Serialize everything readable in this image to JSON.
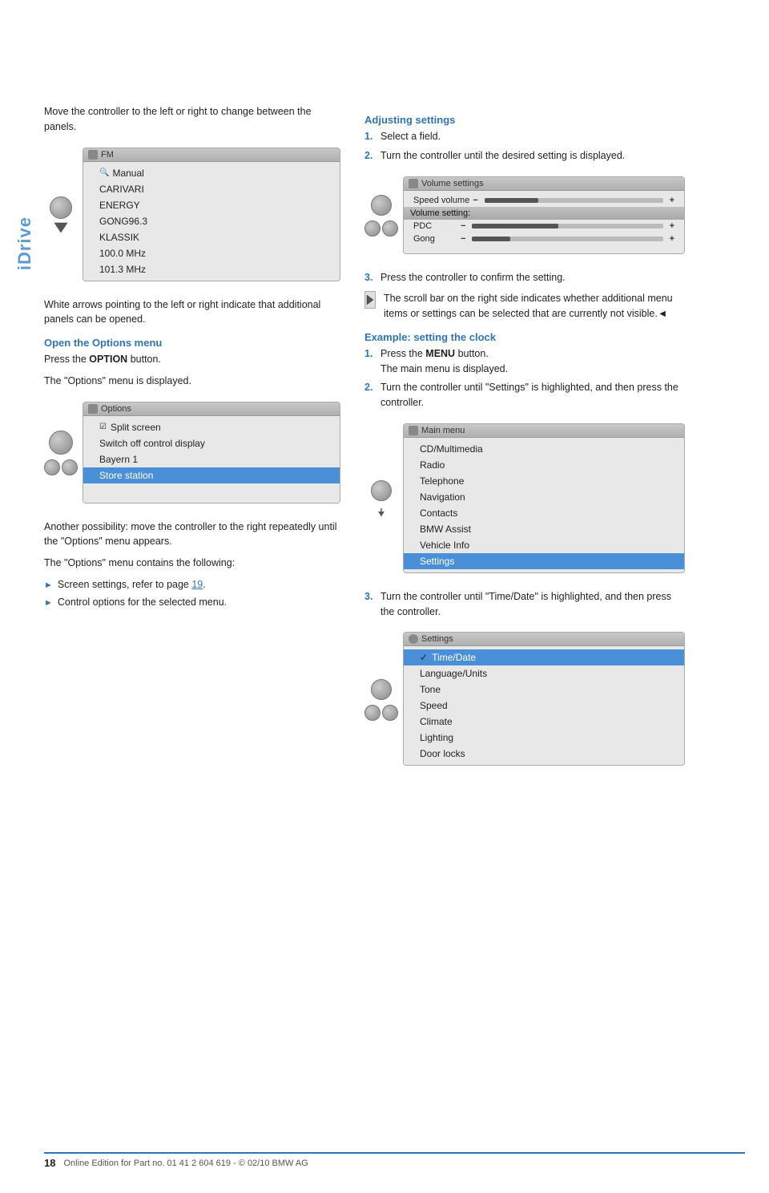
{
  "sidebar": {
    "label": "iDrive"
  },
  "left_col": {
    "intro_text": "Move the controller to the left or right to change between the panels.",
    "screenshot1": {
      "title_icon": "radio-icon",
      "title": "FM",
      "items": [
        {
          "label": "Manual",
          "selected": false,
          "icon": "search"
        },
        {
          "label": "CARIVARI",
          "selected": false
        },
        {
          "label": "ENERGY",
          "selected": false
        },
        {
          "label": "GONG96.3",
          "selected": false
        },
        {
          "label": "KLASSIK",
          "selected": false
        },
        {
          "label": "100.0 MHz",
          "selected": false
        },
        {
          "label": "101.3 MHz",
          "selected": false
        }
      ]
    },
    "white_arrows_text": "White arrows pointing to the left or right indicate that additional panels can be opened.",
    "options_section": {
      "heading": "Open the Options menu",
      "step1": "Press the ",
      "step1_bold": "OPTION",
      "step1_end": " button.",
      "step2": "The \"Options\" menu is displayed.",
      "screenshot2": {
        "title": "Options",
        "items": [
          {
            "label": "Split screen",
            "icon": "checkbox",
            "selected": false
          },
          {
            "label": "Switch off control display",
            "selected": false
          },
          {
            "label": "Bayern 1",
            "selected": false
          },
          {
            "label": "Store station",
            "selected": true
          }
        ]
      },
      "another_possibility": "Another possibility: move the controller to the right repeatedly until the \"Options\" menu appears.",
      "contains_text": "The \"Options\" menu contains the following:",
      "bullets": [
        {
          "text": "Screen settings, refer to page ",
          "link": "19",
          "link_page": "19"
        },
        {
          "text": "Control options for the selected menu."
        }
      ]
    }
  },
  "right_col": {
    "adjusting_settings": {
      "heading": "Adjusting settings",
      "steps": [
        {
          "num": "1.",
          "text": "Select a field."
        },
        {
          "num": "2.",
          "text": "Turn the controller until the desired setting is displayed."
        }
      ],
      "screenshot": {
        "title": "Volume settings",
        "items": [
          {
            "label": "Speed volume",
            "type": "slider",
            "fill": 30
          },
          {
            "label": "Volume setting:",
            "type": "header"
          },
          {
            "label": "PDC",
            "type": "slider",
            "fill": 45
          },
          {
            "label": "Gong",
            "type": "slider",
            "fill": 20
          }
        ]
      },
      "step3": {
        "num": "3.",
        "text": "Press the controller to confirm the setting."
      },
      "note": "The scroll bar on the right side indicates whether additional menu items or settings can be selected that are currently not visible.◄"
    },
    "example_clock": {
      "heading": "Example: setting the clock",
      "steps": [
        {
          "num": "1.",
          "text_pre": "Press the ",
          "bold": "MENU",
          "text_post": " button.\nThe main menu is displayed."
        },
        {
          "num": "2.",
          "text": "Turn the controller until \"Settings\" is highlighted, and then press the controller."
        }
      ],
      "screenshot_main_menu": {
        "title": "Main menu",
        "items": [
          {
            "label": "CD/Multimedia",
            "selected": false
          },
          {
            "label": "Radio",
            "selected": false
          },
          {
            "label": "Telephone",
            "selected": false
          },
          {
            "label": "Navigation",
            "selected": false
          },
          {
            "label": "Contacts",
            "selected": false
          },
          {
            "label": "BMW Assist",
            "selected": false
          },
          {
            "label": "Vehicle Info",
            "selected": false
          },
          {
            "label": "Settings",
            "selected": true
          }
        ]
      },
      "step3": {
        "num": "3.",
        "text": "Turn the controller until \"Time/Date\" is highlighted, and then press the controller."
      },
      "screenshot_settings": {
        "title": "Settings",
        "items": [
          {
            "label": "Time/Date",
            "selected": true,
            "checkmark": true
          },
          {
            "label": "Language/Units",
            "selected": false
          },
          {
            "label": "Tone",
            "selected": false
          },
          {
            "label": "Speed",
            "selected": false
          },
          {
            "label": "Climate",
            "selected": false
          },
          {
            "label": "Lighting",
            "selected": false
          },
          {
            "label": "Door locks",
            "selected": false
          }
        ]
      }
    }
  },
  "footer": {
    "page_number": "18",
    "text": "Online Edition for Part no. 01 41 2 604 619 - © 02/10 BMW AG"
  }
}
